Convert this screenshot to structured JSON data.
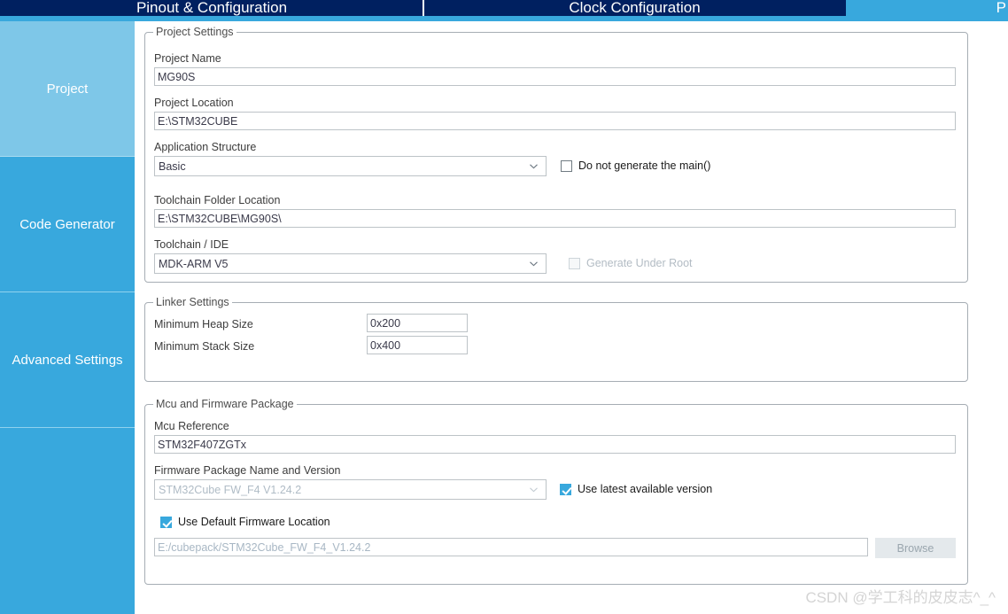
{
  "tabs": [
    {
      "label": "Pinout & Configuration",
      "selected": false
    },
    {
      "label": "Clock Configuration",
      "selected": false
    },
    {
      "label": "P",
      "selected": true
    }
  ],
  "sidebar": {
    "items": [
      {
        "label": "Project",
        "selected": true
      },
      {
        "label": "Code Generator",
        "selected": false
      },
      {
        "label": "Advanced Settings",
        "selected": false
      },
      {
        "label": "",
        "selected": false
      }
    ]
  },
  "project_settings": {
    "group_title": "Project Settings",
    "project_name_label": "Project Name",
    "project_name_value": "MG90S",
    "project_location_label": "Project Location",
    "project_location_value": "E:\\STM32CUBE",
    "application_structure_label": "Application Structure",
    "application_structure_value": "Basic",
    "do_not_generate_main_label": "Do not generate the main()",
    "do_not_generate_main_checked": false,
    "toolchain_folder_label": "Toolchain Folder Location",
    "toolchain_folder_value": "E:\\STM32CUBE\\MG90S\\",
    "toolchain_ide_label": "Toolchain / IDE",
    "toolchain_ide_value": "MDK-ARM V5",
    "generate_under_root_label": "Generate Under Root",
    "generate_under_root_checked": false,
    "generate_under_root_disabled": true
  },
  "linker_settings": {
    "group_title": "Linker Settings",
    "min_heap_label": "Minimum Heap Size",
    "min_heap_value": "0x200",
    "min_stack_label": "Minimum Stack Size",
    "min_stack_value": "0x400"
  },
  "mcu_firmware": {
    "group_title": "Mcu and Firmware Package",
    "mcu_reference_label": "Mcu Reference",
    "mcu_reference_value": "STM32F407ZGTx",
    "firmware_package_label": "Firmware Package Name and Version",
    "firmware_package_value": "STM32Cube FW_F4 V1.24.2",
    "firmware_package_disabled": true,
    "use_latest_label": "Use latest available version",
    "use_latest_checked": true,
    "use_default_location_label": "Use Default Firmware Location",
    "use_default_location_checked": true,
    "firmware_location_value": "E:/cubepack/STM32Cube_FW_F4_V1.24.2",
    "firmware_location_disabled": true,
    "browse_label": "Browse",
    "browse_disabled": true
  },
  "watermark": "CSDN @学工科的皮皮志^_^",
  "colors": {
    "tabbar_bg": "#002060",
    "accent": "#38a8dd",
    "sidebar_selected": "#7ec7e8",
    "groupbox_border": "#a6adb4"
  }
}
